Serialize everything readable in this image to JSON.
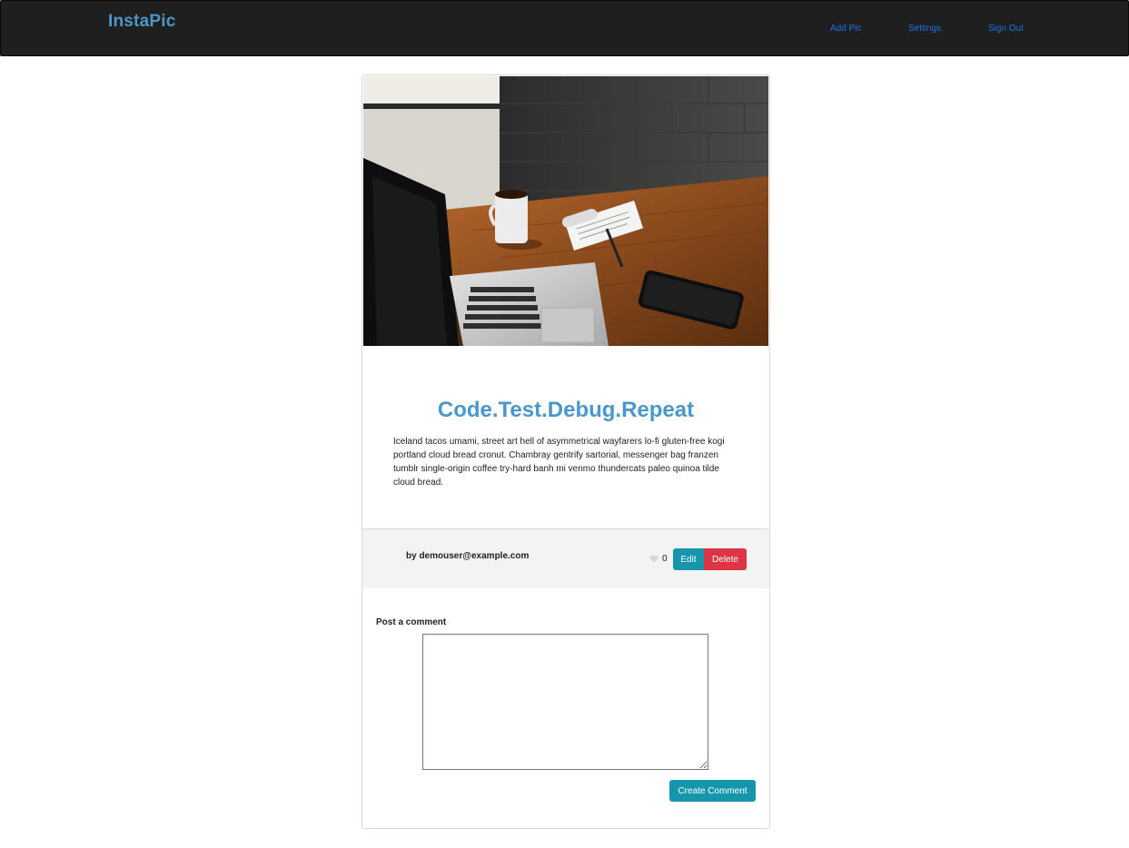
{
  "navbar": {
    "brand": "InstaPic",
    "links": {
      "add_pic": "Add Pic",
      "settings": "Settings",
      "sign_out": "Sign Out"
    }
  },
  "post": {
    "title": "Code.Test.Debug.Repeat",
    "body": "Iceland tacos umami, street art hell of asymmetrical wayfarers lo-fi gluten-free kogi portland cloud bread cronut. Chambray gentrify sartorial, messenger bag franzen tumblr single-origin coffee try-hard banh mi venmo thundercats paleo quinoa tilde cloud bread.",
    "author": "by demouser@example.com",
    "like_count": "0",
    "edit_label": "Edit",
    "delete_label": "Delete"
  },
  "comment": {
    "label": "Post a comment",
    "value": "",
    "submit_label": "Create Comment"
  },
  "colors": {
    "navbar_bg": "#1f1f1f",
    "brand": "#4a97c9",
    "link": "#1a73e8",
    "info": "#1596ad",
    "danger": "#dc3545"
  },
  "icons": {
    "like": "heart-icon"
  }
}
